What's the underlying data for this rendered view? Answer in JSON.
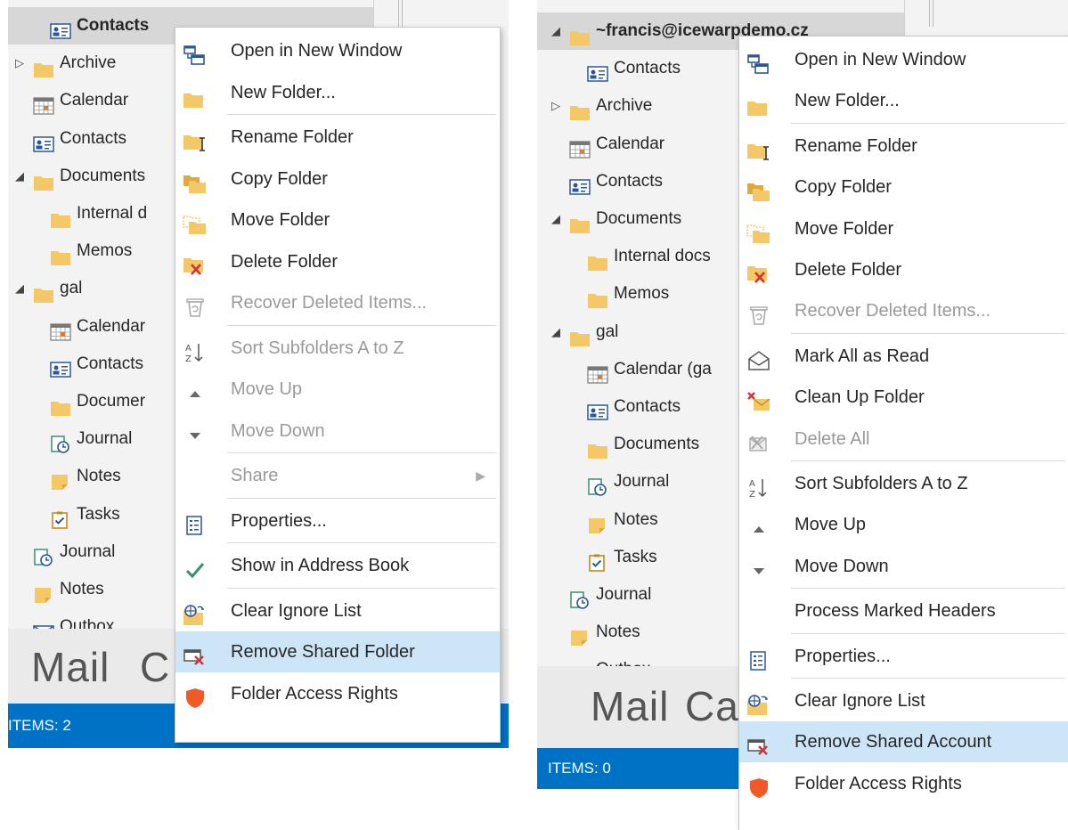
{
  "left": {
    "tree": [
      {
        "label": "Contacts",
        "icon": "contacts-icon",
        "selected": true
      },
      {
        "label": "Archive",
        "icon": "folder-icon",
        "expander": "collapsed"
      },
      {
        "label": "Calendar",
        "icon": "calendar-icon"
      },
      {
        "label": "Contacts",
        "icon": "contacts-icon"
      },
      {
        "label": "Documents",
        "icon": "folder-icon",
        "expander": "expanded"
      },
      {
        "label": "Internal d",
        "icon": "folder-icon"
      },
      {
        "label": "Memos",
        "icon": "folder-icon"
      },
      {
        "label": "gal",
        "icon": "folder-icon",
        "expander": "expanded"
      },
      {
        "label": "Calendar",
        "icon": "calendar-icon"
      },
      {
        "label": "Contacts",
        "icon": "contacts-icon"
      },
      {
        "label": "Documer",
        "icon": "folder-icon"
      },
      {
        "label": "Journal",
        "icon": "journal-icon"
      },
      {
        "label": "Notes",
        "icon": "notes-icon"
      },
      {
        "label": "Tasks",
        "icon": "tasks-icon"
      },
      {
        "label": "Journal",
        "icon": "journal-icon"
      },
      {
        "label": "Notes",
        "icon": "notes-icon"
      },
      {
        "label": "Outbox",
        "icon": "outbox-icon"
      }
    ],
    "nav": {
      "mail": "Mail",
      "second": "C"
    },
    "status": "ITEMS: 2",
    "menu": [
      {
        "label": "Open in New Window",
        "icon": "new-window-icon"
      },
      {
        "label": "New Folder...",
        "icon": "folder-icon",
        "sep_after": true
      },
      {
        "label": "Rename Folder",
        "icon": "rename-folder-icon"
      },
      {
        "label": "Copy Folder",
        "icon": "copy-folder-icon"
      },
      {
        "label": "Move Folder",
        "icon": "move-folder-icon"
      },
      {
        "label": "Delete Folder",
        "icon": "delete-folder-icon"
      },
      {
        "label": "Recover Deleted Items...",
        "icon": "recover-icon",
        "disabled": true,
        "sep_after": true
      },
      {
        "label": "Sort Subfolders A to Z",
        "icon": "sort-icon",
        "disabled": true
      },
      {
        "label": "Move Up",
        "icon": "up-triangle-icon",
        "disabled": true
      },
      {
        "label": "Move Down",
        "icon": "down-triangle-icon",
        "disabled": true,
        "sep_after": true
      },
      {
        "label": "Share",
        "icon": "",
        "disabled": true,
        "submenu": true,
        "sep_after": true
      },
      {
        "label": "Properties...",
        "icon": "properties-icon",
        "sep_after": true
      },
      {
        "label": "Show in Address Book",
        "icon": "checkmark-icon",
        "sep_after": true
      },
      {
        "label": "Clear Ignore List",
        "icon": "clear-ignore-icon"
      },
      {
        "label": "Remove Shared Folder",
        "icon": "remove-shared-icon",
        "highlight": true
      },
      {
        "label": "Folder Access Rights",
        "icon": "shield-icon"
      }
    ]
  },
  "right": {
    "tree": [
      {
        "label": "~francis@icewarpdemo.cz",
        "icon": "folder-icon",
        "expander": "expanded",
        "selected": true
      },
      {
        "label": "Contacts",
        "icon": "contacts-icon"
      },
      {
        "label": "Archive",
        "icon": "folder-icon",
        "expander": "collapsed"
      },
      {
        "label": "Calendar",
        "icon": "calendar-icon"
      },
      {
        "label": "Contacts",
        "icon": "contacts-icon"
      },
      {
        "label": "Documents",
        "icon": "folder-icon",
        "expander": "expanded"
      },
      {
        "label": "Internal docs",
        "icon": "folder-icon"
      },
      {
        "label": "Memos",
        "icon": "folder-icon"
      },
      {
        "label": "gal",
        "icon": "folder-icon",
        "expander": "expanded"
      },
      {
        "label": "Calendar (ga",
        "icon": "calendar-icon"
      },
      {
        "label": "Contacts",
        "icon": "contacts-icon"
      },
      {
        "label": "Documents",
        "icon": "folder-icon"
      },
      {
        "label": "Journal",
        "icon": "journal-icon"
      },
      {
        "label": "Notes",
        "icon": "notes-icon"
      },
      {
        "label": "Tasks",
        "icon": "tasks-icon"
      },
      {
        "label": "Journal",
        "icon": "journal-icon"
      },
      {
        "label": "Notes",
        "icon": "notes-icon"
      },
      {
        "label": "Outbox",
        "icon": "outbox-icon"
      }
    ],
    "nav": {
      "mail": "Mail",
      "second": "Cal"
    },
    "status": "ITEMS: 0",
    "menu": [
      {
        "label": "Open in New Window",
        "icon": "new-window-icon"
      },
      {
        "label": "New Folder...",
        "icon": "folder-icon",
        "sep_after": true
      },
      {
        "label": "Rename Folder",
        "icon": "rename-folder-icon"
      },
      {
        "label": "Copy Folder",
        "icon": "copy-folder-icon"
      },
      {
        "label": "Move Folder",
        "icon": "move-folder-icon"
      },
      {
        "label": "Delete Folder",
        "icon": "delete-folder-icon"
      },
      {
        "label": "Recover Deleted Items...",
        "icon": "recover-icon",
        "disabled": true,
        "sep_after": true
      },
      {
        "label": "Mark All as Read",
        "icon": "envelope-open-icon"
      },
      {
        "label": "Clean Up Folder",
        "icon": "clean-up-icon"
      },
      {
        "label": "Delete All",
        "icon": "delete-all-icon",
        "disabled": true,
        "sep_after": true
      },
      {
        "label": "Sort Subfolders A to Z",
        "icon": "sort-icon"
      },
      {
        "label": "Move Up",
        "icon": "up-triangle-icon"
      },
      {
        "label": "Move Down",
        "icon": "down-triangle-icon",
        "sep_after": true
      },
      {
        "label": "Process Marked Headers",
        "icon": "",
        "sep_after": true
      },
      {
        "label": "Properties...",
        "icon": "properties-icon",
        "sep_after": true
      },
      {
        "label": "Clear Ignore List",
        "icon": "clear-ignore-icon"
      },
      {
        "label": "Remove Shared Account",
        "icon": "remove-shared-icon",
        "highlight": true
      },
      {
        "label": "Folder Access Rights",
        "icon": "shield-icon"
      }
    ]
  },
  "colors": {
    "status_bar": "#0072c6",
    "highlight": "#cde6f7",
    "folder": "#f5c867",
    "shield": "#f05a28",
    "check": "#3a8f6a",
    "delete_x": "#d13438"
  }
}
